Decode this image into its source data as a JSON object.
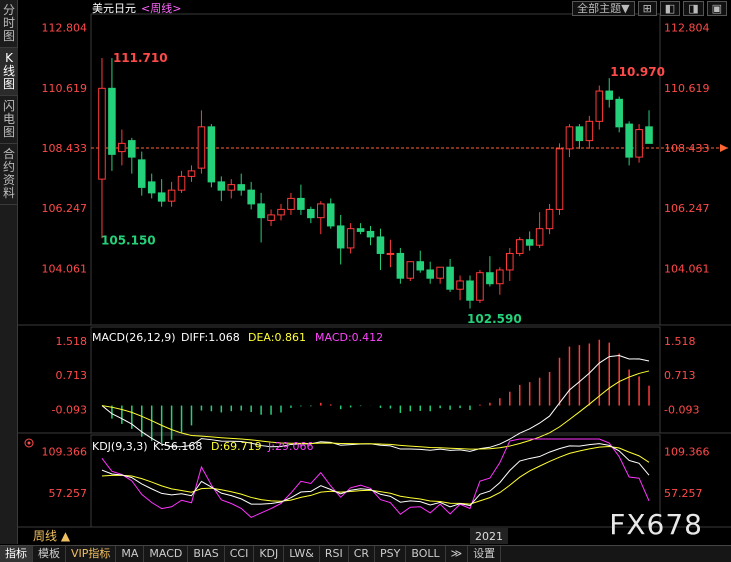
{
  "left_tabs": [
    "分时图",
    "K线图",
    "闪电图",
    "合约资料"
  ],
  "top_controls": {
    "theme_label": "全部主题▼",
    "btn_prev": "⊞",
    "btn_a": "◧",
    "btn_b": "◨",
    "btn_c": "▣"
  },
  "main_chart": {
    "title": "美元日元",
    "period": "<周线>",
    "y_ticks": [
      "112.804",
      "110.619",
      "108.433",
      "106.247",
      "104.061"
    ],
    "current_price_label": "108.433",
    "annotations": {
      "high_left": "111.710",
      "low_left": "105.150",
      "low_mid": "102.590",
      "high_right": "110.970"
    }
  },
  "macd_panel": {
    "header": "MACD(26,12,9)",
    "diff": "DIFF:1.068",
    "dea": "DEA:0.861",
    "macd": "MACD:0.412",
    "y_ticks": [
      "1.518",
      "0.713",
      "-0.093"
    ]
  },
  "kdj_panel": {
    "header": "KDJ(9,3,3)",
    "k": "K:56.168",
    "d": "D:69.719",
    "j": "J:29.066",
    "y_ticks": [
      "109.366",
      "57.257"
    ]
  },
  "x_axis": {
    "year_label": "2021"
  },
  "period_strip": "周线 ▲",
  "bottom_tabs": [
    "指标",
    "模板",
    "VIP指标",
    "MA",
    "MACD",
    "BIAS",
    "CCI",
    "KDJ",
    "LW&",
    "RSI",
    "CR",
    "PSY",
    "BOLL",
    "≫",
    "设置"
  ],
  "watermark": "FX678",
  "colors": {
    "up": "#ff3b3b",
    "down": "#25d07a",
    "diff": "#ffffff",
    "dea": "#ffff33",
    "kline": "#ffffff",
    "dline": "#ffff33",
    "jline": "#ff33ff",
    "axis_text": "#ff4a4a"
  },
  "chart_data": {
    "type": "candlestick",
    "series_ohlc": [
      [
        107.3,
        111.7,
        105.15,
        110.6
      ],
      [
        110.6,
        111.7,
        107.6,
        108.2
      ],
      [
        108.3,
        109.1,
        107.8,
        108.6
      ],
      [
        108.7,
        108.8,
        107.5,
        108.1
      ],
      [
        108.0,
        108.3,
        106.7,
        107.0
      ],
      [
        107.2,
        107.5,
        106.6,
        106.8
      ],
      [
        106.8,
        107.3,
        106.3,
        106.5
      ],
      [
        106.5,
        107.2,
        106.3,
        106.9
      ],
      [
        106.9,
        107.6,
        106.8,
        107.4
      ],
      [
        107.4,
        107.8,
        107.2,
        107.6
      ],
      [
        107.7,
        109.8,
        107.5,
        109.2
      ],
      [
        109.2,
        109.3,
        107.0,
        107.2
      ],
      [
        107.2,
        107.4,
        106.5,
        106.9
      ],
      [
        106.9,
        107.3,
        106.6,
        107.1
      ],
      [
        107.1,
        107.5,
        106.7,
        106.9
      ],
      [
        106.9,
        107.2,
        106.2,
        106.4
      ],
      [
        106.4,
        106.8,
        105.0,
        105.9
      ],
      [
        105.8,
        106.2,
        105.6,
        106.0
      ],
      [
        106.0,
        106.4,
        105.8,
        106.2
      ],
      [
        106.2,
        106.8,
        106.0,
        106.6
      ],
      [
        106.6,
        107.1,
        106.0,
        106.2
      ],
      [
        106.2,
        106.3,
        105.7,
        105.9
      ],
      [
        105.9,
        106.5,
        105.3,
        106.4
      ],
      [
        106.4,
        106.6,
        105.5,
        105.6
      ],
      [
        105.6,
        106.0,
        104.2,
        104.8
      ],
      [
        104.8,
        105.7,
        104.6,
        105.5
      ],
      [
        105.5,
        105.7,
        105.3,
        105.4
      ],
      [
        105.4,
        105.6,
        104.9,
        105.2
      ],
      [
        105.2,
        105.5,
        104.0,
        104.6
      ],
      [
        104.6,
        105.1,
        104.1,
        104.6
      ],
      [
        104.6,
        104.8,
        103.5,
        103.7
      ],
      [
        103.7,
        104.3,
        103.6,
        104.3
      ],
      [
        104.3,
        104.7,
        103.9,
        104.0
      ],
      [
        104.0,
        104.3,
        103.5,
        103.7
      ],
      [
        103.7,
        104.1,
        103.5,
        104.1
      ],
      [
        104.1,
        104.4,
        103.2,
        103.3
      ],
      [
        103.3,
        103.8,
        102.9,
        103.6
      ],
      [
        103.6,
        103.8,
        102.6,
        102.9
      ],
      [
        102.9,
        104.0,
        102.8,
        103.9
      ],
      [
        103.9,
        104.5,
        103.4,
        103.5
      ],
      [
        103.5,
        104.1,
        103.1,
        104.0
      ],
      [
        104.0,
        104.8,
        103.6,
        104.6
      ],
      [
        104.6,
        105.2,
        104.5,
        105.1
      ],
      [
        105.1,
        105.4,
        104.7,
        104.9
      ],
      [
        104.9,
        106.1,
        104.8,
        105.5
      ],
      [
        105.5,
        106.4,
        105.3,
        106.2
      ],
      [
        106.2,
        108.6,
        106.0,
        108.4
      ],
      [
        108.4,
        109.3,
        108.1,
        109.2
      ],
      [
        109.2,
        109.3,
        108.4,
        108.7
      ],
      [
        108.7,
        109.6,
        108.4,
        109.4
      ],
      [
        109.4,
        110.7,
        109.1,
        110.5
      ],
      [
        110.5,
        110.97,
        109.9,
        110.2
      ],
      [
        110.2,
        110.3,
        109.0,
        109.2
      ],
      [
        109.3,
        109.4,
        107.8,
        108.1
      ],
      [
        108.1,
        109.3,
        107.9,
        109.1
      ],
      [
        109.2,
        109.8,
        108.6,
        108.6
      ]
    ],
    "ylim": [
      102.0,
      113.3
    ],
    "xlabel": "2021"
  }
}
